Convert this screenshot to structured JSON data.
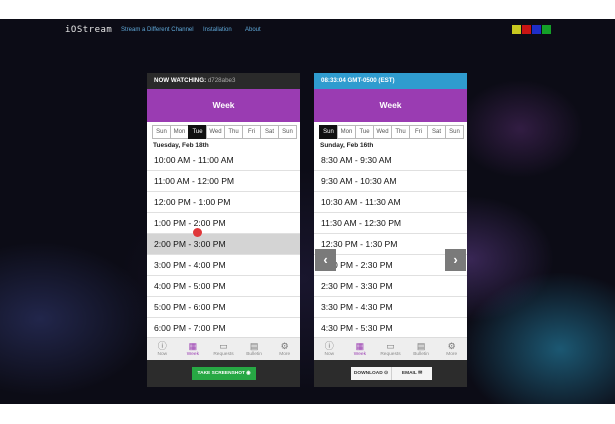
{
  "nav": {
    "brand": "iOStream",
    "links": [
      "Stream a Different Channel",
      "Installation",
      "About"
    ],
    "swatch_colors": [
      "#c8c820",
      "#c81414",
      "#1e2ec8",
      "#14a028"
    ]
  },
  "left": {
    "header_label": "NOW WATCHING:",
    "header_value": "d728abe3",
    "week_title": "Week",
    "days": [
      "Sun",
      "Mon",
      "Tue",
      "Wed",
      "Thu",
      "Fri",
      "Sat",
      "Sun"
    ],
    "selected_day": "Tue",
    "date": "Tuesday, Feb 18th",
    "slots": [
      "10:00 AM - 11:00 AM",
      "11:00 AM - 12:00 PM",
      "12:00 PM - 1:00 PM",
      "1:00 PM - 2:00 PM",
      "2:00 PM - 3:00 PM",
      "3:00 PM - 4:00 PM",
      "4:00 PM - 5:00 PM",
      "5:00 PM - 6:00 PM",
      "6:00 PM - 7:00 PM"
    ],
    "highlighted_slot": "2:00 PM - 3:00 PM",
    "tabs": [
      "Now",
      "Week",
      "Requests",
      "Bulletin",
      "More"
    ],
    "active_tab": "Week",
    "action_button": "TAKE SCREENSHOT"
  },
  "right": {
    "clock": "08:33:04 GMT-0500 (EST)",
    "week_title": "Week",
    "days": [
      "Sun",
      "Mon",
      "Tue",
      "Wed",
      "Thu",
      "Fri",
      "Sat",
      "Sun"
    ],
    "selected_day": "Sun",
    "date": "Sunday, Feb 16th",
    "slots": [
      "8:30 AM - 9:30 AM",
      "9:30 AM - 10:30 AM",
      "10:30 AM - 11:30 AM",
      "11:30 AM - 12:30 PM",
      "12:30 PM - 1:30 PM",
      "1:30 PM - 2:30 PM",
      "2:30 PM - 3:30 PM",
      "3:30 PM - 4:30 PM",
      "4:30 PM - 5:30 PM"
    ],
    "tabs": [
      "Now",
      "Week",
      "Requests",
      "Bulletin",
      "More"
    ],
    "active_tab": "Week",
    "download_button": "DOWNLOAD",
    "email_button": "EMAIL"
  },
  "colors": {
    "accent_purple": "#9a3cb2",
    "header_blue": "#2f9ccf",
    "screenshot_green": "#27a844"
  },
  "icons": {
    "tab_icons": [
      "info-icon",
      "calendar-icon",
      "inbox-icon",
      "bulletin-icon",
      "gear-icon"
    ],
    "prev": "chevron-left-icon",
    "next": "chevron-right-icon"
  }
}
